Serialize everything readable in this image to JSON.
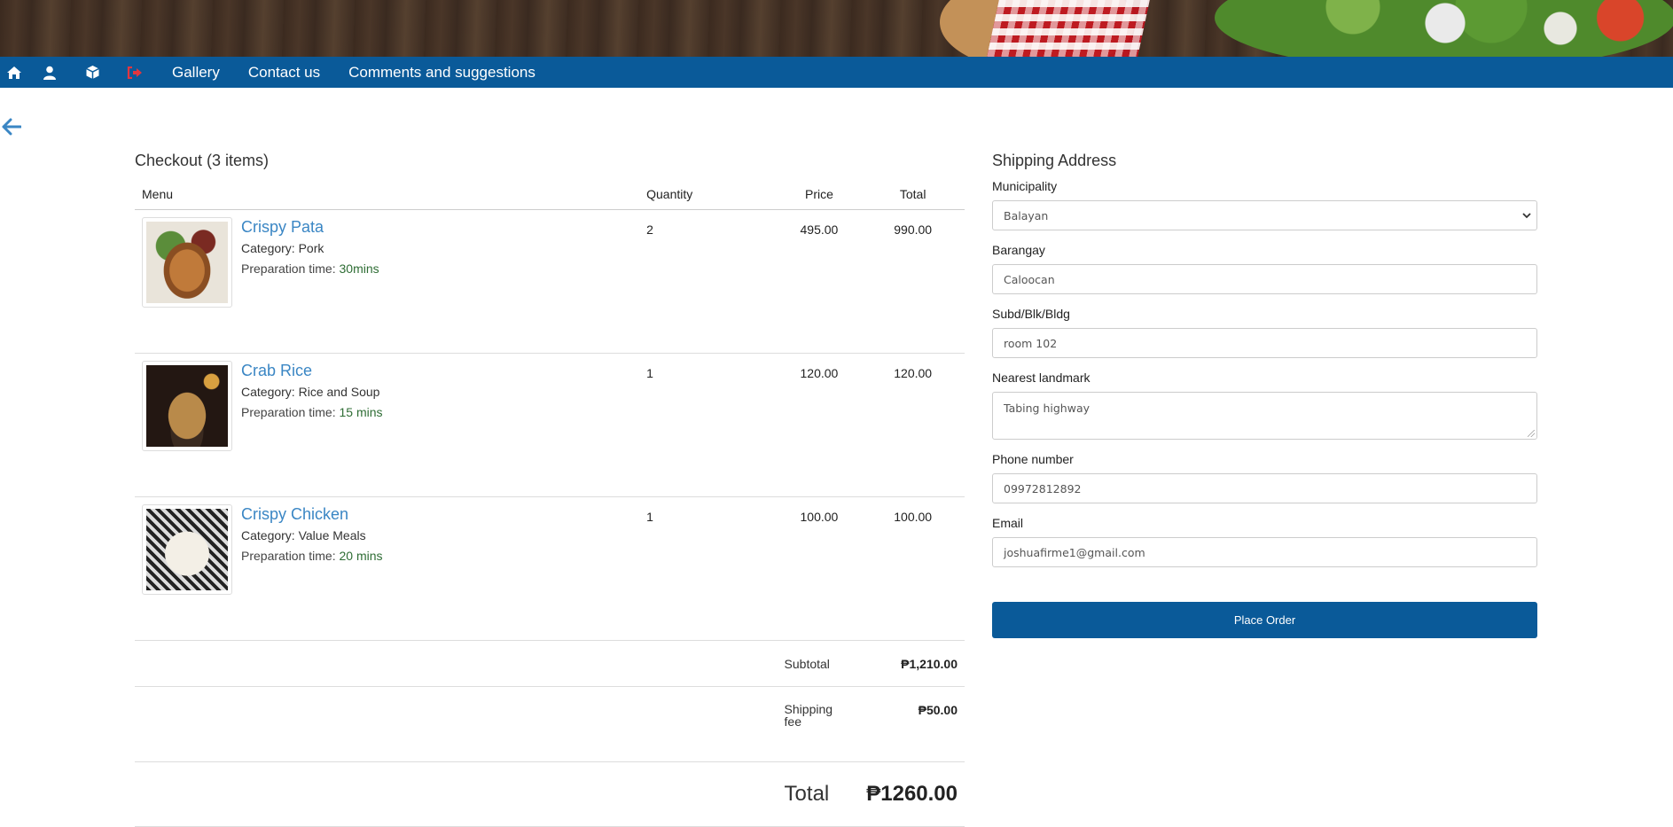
{
  "nav": {
    "icons": [
      "home-icon",
      "user-icon",
      "cube-icon",
      "sign-out-icon"
    ],
    "links": [
      "Gallery",
      "Contact us",
      "Comments and suggestions"
    ],
    "color": "#0a5a99",
    "logout_color": "#e2363f"
  },
  "checkout": {
    "title": "Checkout (3 items)",
    "columns": {
      "menu": "Menu",
      "quantity": "Quantity",
      "price": "Price",
      "total": "Total"
    },
    "items": [
      {
        "name": "Crispy Pata",
        "category_label": "Category: ",
        "category": "Pork",
        "prep_label": "Preparation time: ",
        "prep": "30mins",
        "quantity": "2",
        "price": "495.00",
        "total": "990.00"
      },
      {
        "name": "Crab Rice",
        "category_label": "Category: ",
        "category": "Rice and Soup",
        "prep_label": "Preparation time: ",
        "prep": "15 mins",
        "quantity": "1",
        "price": "120.00",
        "total": "120.00"
      },
      {
        "name": "Crispy Chicken",
        "category_label": "Category: ",
        "category": "Value Meals",
        "prep_label": "Preparation time: ",
        "prep": "20 mins",
        "quantity": "1",
        "price": "100.00",
        "total": "100.00"
      }
    ],
    "subtotal_label": "Subtotal",
    "subtotal": "₱1,210.00",
    "shipping_label_1": "Shipping",
    "shipping_label_2": "fee",
    "shipping": "₱50.00",
    "total_label": "Total",
    "total": "₱1260.00"
  },
  "shipping": {
    "title": "Shipping Address",
    "municipality_label": "Municipality",
    "municipality": "Balayan",
    "barangay_label": "Barangay",
    "barangay": "Caloocan",
    "subd_label": "Subd/Blk/Bldg",
    "subd": "room 102",
    "landmark_label": "Nearest landmark",
    "landmark": "Tabing highway",
    "phone_label": "Phone number",
    "phone": "09972812892",
    "email_label": "Email",
    "email": "joshuafirme1@gmail.com",
    "place_order": "Place Order"
  }
}
